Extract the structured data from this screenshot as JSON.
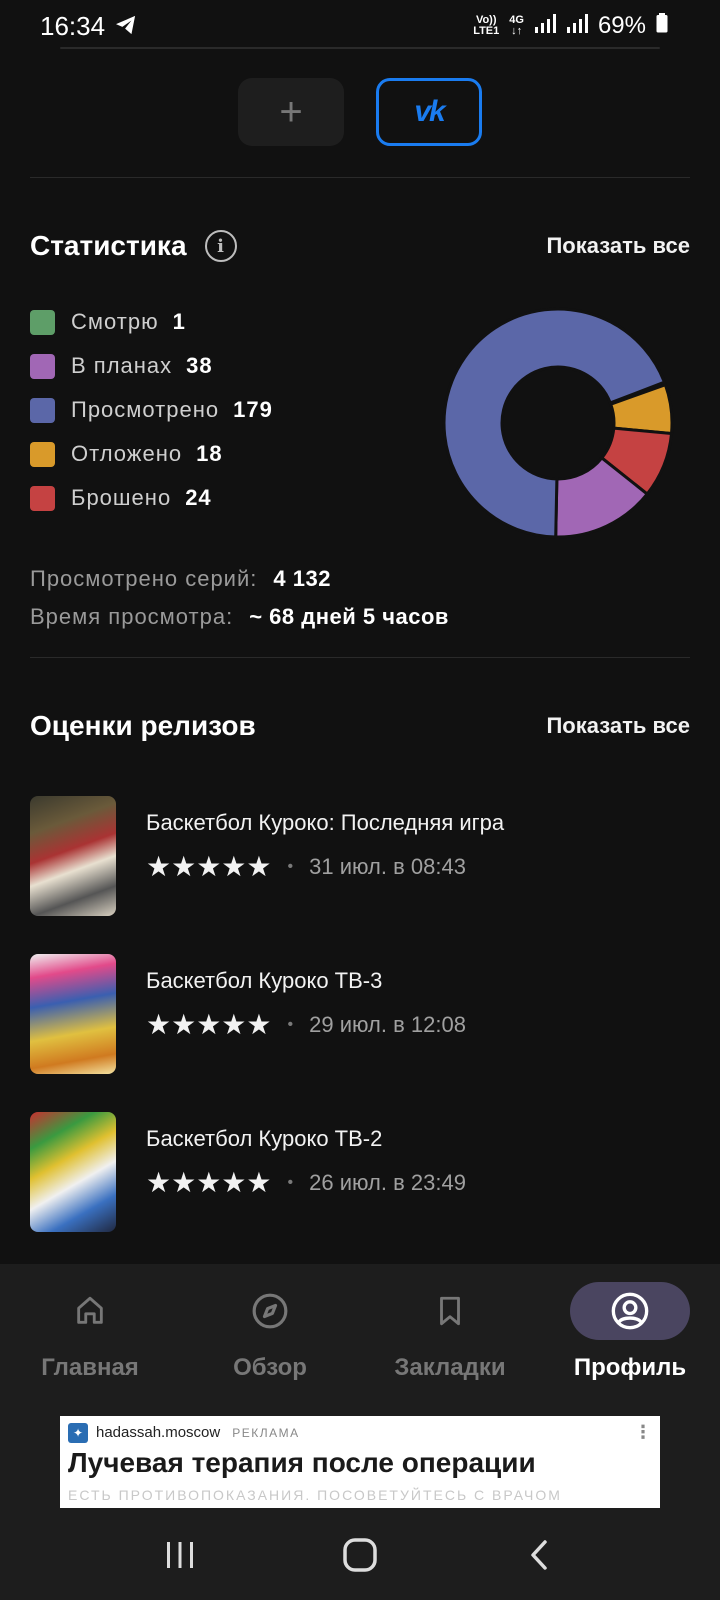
{
  "status_bar": {
    "time": "16:34",
    "volte_top": "Vo))",
    "volte_bottom": "LTE1",
    "network": "4G",
    "battery": "69%"
  },
  "social": {
    "add_label": "+",
    "vk_label": "vk"
  },
  "statistics": {
    "title": "Статистика",
    "show_all": "Показать все",
    "legend": [
      {
        "label": "Смотрю",
        "count": "1",
        "color": "#5e9e68"
      },
      {
        "label": "В планах",
        "count": "38",
        "color": "#a167b5"
      },
      {
        "label": "Просмотрено",
        "count": "179",
        "color": "#5b67a8"
      },
      {
        "label": "Отложено",
        "count": "18",
        "color": "#d99a2a"
      },
      {
        "label": "Брошено",
        "count": "24",
        "color": "#c54242"
      }
    ],
    "episodes_label": "Просмотрено серий:",
    "episodes_value": "4 132",
    "time_label": "Время просмотра:",
    "time_value": "~ 68 дней 5 часов"
  },
  "ratings": {
    "title": "Оценки релизов",
    "show_all": "Показать все",
    "items": [
      {
        "title": "Баскетбол Куроко: Последняя игра",
        "stars": "★★★★★",
        "date": "31 июл. в 08:43"
      },
      {
        "title": "Баскетбол Куроко ТВ-3",
        "stars": "★★★★★",
        "date": "29 июл. в 12:08"
      },
      {
        "title": "Баскетбол Куроко ТВ-2",
        "stars": "★★★★★",
        "date": "26 июл. в 23:49"
      }
    ]
  },
  "nav": {
    "items": [
      {
        "label": "Главная",
        "icon": "home-icon"
      },
      {
        "label": "Обзор",
        "icon": "compass-icon"
      },
      {
        "label": "Закладки",
        "icon": "bookmark-icon"
      },
      {
        "label": "Профиль",
        "icon": "profile-icon",
        "active": true
      }
    ]
  },
  "ad": {
    "domain": "hadassah.moscow",
    "tag": "РЕКЛАМА",
    "headline": "Лучевая терапия после операции",
    "disclaimer": "ЕСТЬ ПРОТИВОПОКАЗАНИЯ. ПОСОВЕТУЙТЕСЬ С ВРАЧОМ"
  }
}
